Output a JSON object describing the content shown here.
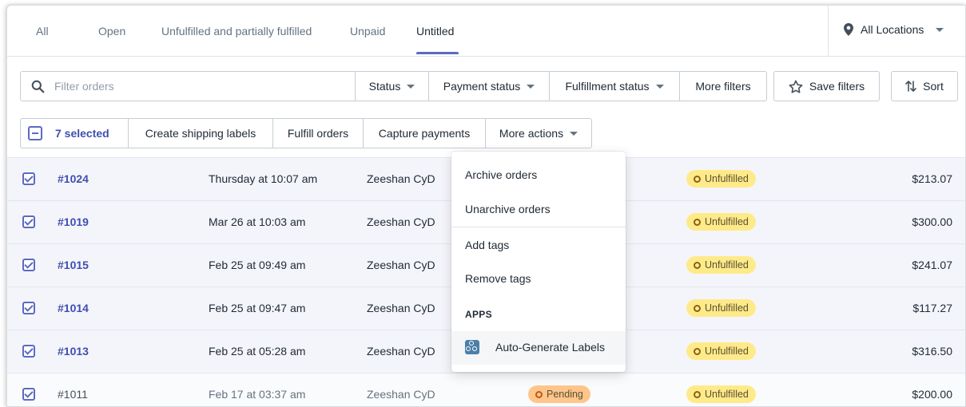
{
  "tabs": [
    {
      "label": "All"
    },
    {
      "label": "Open"
    },
    {
      "label": "Unfulfilled and partially fulfilled"
    },
    {
      "label": "Unpaid"
    },
    {
      "label": "Untitled",
      "active": true
    }
  ],
  "location": {
    "label": "All Locations"
  },
  "filters": {
    "search_placeholder": "Filter orders",
    "status": "Status",
    "payment_status": "Payment status",
    "fulfillment_status": "Fulfillment status",
    "more_filters": "More filters",
    "save_filters": "Save filters",
    "sort": "Sort"
  },
  "bulk": {
    "selected": "7 selected",
    "create_labels": "Create shipping labels",
    "fulfill": "Fulfill orders",
    "capture": "Capture payments",
    "more_actions": "More actions"
  },
  "orders": [
    {
      "number": "#1024",
      "date": "Thursday at 10:07 am",
      "customer": "Zeeshan CyD",
      "fulfillment": "Unfulfilled",
      "total": "$213.07"
    },
    {
      "number": "#1019",
      "date": "Mar 26 at 10:03 am",
      "customer": "Zeeshan CyD",
      "fulfillment": "Unfulfilled",
      "total": "$300.00"
    },
    {
      "number": "#1015",
      "date": "Feb 25 at 09:49 am",
      "customer": "Zeeshan CyD",
      "fulfillment": "Unfulfilled",
      "total": "$241.07"
    },
    {
      "number": "#1014",
      "date": "Feb 25 at 09:47 am",
      "customer": "Zeeshan CyD",
      "fulfillment": "Unfulfilled",
      "total": "$117.27"
    },
    {
      "number": "#1013",
      "date": "Feb 25 at 05:28 am",
      "customer": "Zeeshan CyD",
      "fulfillment": "Unfulfilled",
      "total": "$316.50"
    },
    {
      "number": "#1011",
      "date": "Feb 17 at 03:37 am",
      "customer": "Zeeshan CyD",
      "payment": "Pending",
      "fulfillment": "Unfulfilled",
      "total": "$200.00"
    }
  ],
  "menu": {
    "archive": "Archive orders",
    "unarchive": "Unarchive orders",
    "add_tags": "Add tags",
    "remove_tags": "Remove tags",
    "apps_heading": "APPS",
    "app_item": "Auto-Generate Labels"
  },
  "colors": {
    "accent": "#5c6ac4",
    "link": "#3f4eae",
    "unfulfilled_badge": "#ffea8a",
    "pending_badge": "#ffc58b"
  }
}
